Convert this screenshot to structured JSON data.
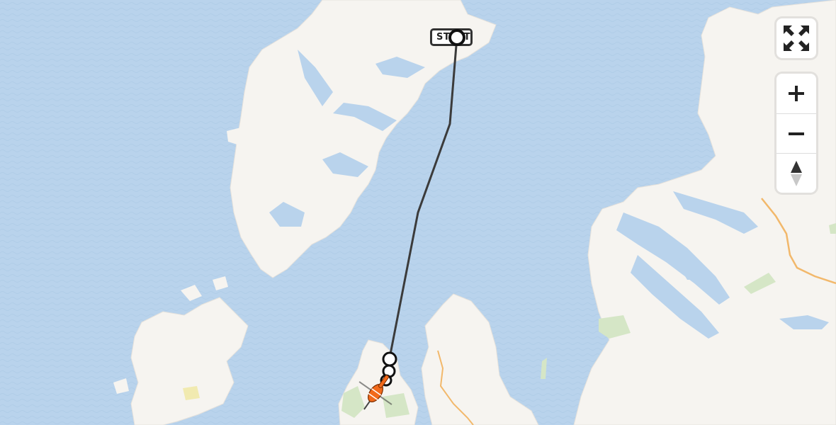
{
  "map": {
    "start_marker_label": "START",
    "colors": {
      "water": "#b9d3ec",
      "land": "#f6f4f0",
      "forest": "#d5e6c6",
      "route": "#3b3b3b",
      "road": "#f2b86b",
      "helicopter": "#f26a1b"
    },
    "icons": [
      "start-pin-icon",
      "waypoint-icon",
      "helicopter-icon"
    ]
  },
  "controls": {
    "fullscreen_icon": "fullscreen-icon",
    "zoom_in_icon": "plus-icon",
    "zoom_out_icon": "minus-icon",
    "compass_icon": "compass-north-icon"
  }
}
